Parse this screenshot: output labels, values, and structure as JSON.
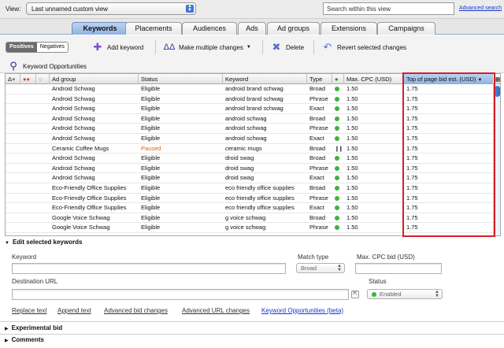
{
  "topbar": {
    "view_label": "View:",
    "view_value": "Last unnamed custom view",
    "search_placeholder": "Search within this view",
    "advanced_search": "Advanced search"
  },
  "tabs": [
    {
      "label": "Keywords",
      "active": true
    },
    {
      "label": "Placements"
    },
    {
      "label": "Audiences"
    },
    {
      "label": "Ads"
    },
    {
      "label": "Ad groups"
    },
    {
      "label": "Extensions"
    },
    {
      "label": "Campaigns"
    }
  ],
  "toolbar": {
    "positives": "Positives",
    "negatives": "Negatives",
    "add_keyword": "Add keyword",
    "make_multiple": "Make multiple changes",
    "delete": "Delete",
    "revert": "Revert selected changes",
    "keyword_opportunities": "Keyword Opportunities"
  },
  "grid": {
    "columns": [
      "Ad group",
      "Status",
      "Keyword",
      "Type",
      "Max. CPC (USD)",
      "Top of page bid est. (USD)"
    ],
    "rows": [
      {
        "ad_group": "Android Schwag",
        "status": "Eligible",
        "keyword": "android brand schwag",
        "type": "Broad",
        "icon": "dot",
        "cpc": "1.50",
        "top": "1.75"
      },
      {
        "ad_group": "Android Schwag",
        "status": "Eligible",
        "keyword": "android brand schwag",
        "type": "Phrase",
        "icon": "dot",
        "cpc": "1.50",
        "top": "1.75"
      },
      {
        "ad_group": "Android Schwag",
        "status": "Eligible",
        "keyword": "android brand schwag",
        "type": "Exact",
        "icon": "dot",
        "cpc": "1.50",
        "top": "1.75"
      },
      {
        "ad_group": "Android Schwag",
        "status": "Eligible",
        "keyword": "android schwag",
        "type": "Broad",
        "icon": "dot",
        "cpc": "1.50",
        "top": "1.75"
      },
      {
        "ad_group": "Android Schwag",
        "status": "Eligible",
        "keyword": "android schwag",
        "type": "Phrase",
        "icon": "dot",
        "cpc": "1.50",
        "top": "1.75"
      },
      {
        "ad_group": "Android Schwag",
        "status": "Eligible",
        "keyword": "android schwag",
        "type": "Exact",
        "icon": "dot",
        "cpc": "1.50",
        "top": "1.75"
      },
      {
        "ad_group": "Ceramic Coffee Mugs",
        "status": "Paused",
        "keyword": "ceramic mugs",
        "type": "Broad",
        "icon": "pause",
        "cpc": "1.50",
        "top": "1.75"
      },
      {
        "ad_group": "Android Schwag",
        "status": "Eligible",
        "keyword": "droid swag",
        "type": "Broad",
        "icon": "dot",
        "cpc": "1.50",
        "top": "1.75"
      },
      {
        "ad_group": "Android Schwag",
        "status": "Eligible",
        "keyword": "droid swag",
        "type": "Phrase",
        "icon": "dot",
        "cpc": "1.50",
        "top": "1.75"
      },
      {
        "ad_group": "Android Schwag",
        "status": "Eligible",
        "keyword": "droid swag",
        "type": "Exact",
        "icon": "dot",
        "cpc": "1.50",
        "top": "1.75"
      },
      {
        "ad_group": "Eco-Friendly Office Supplies",
        "status": "Eligible",
        "keyword": "eco friendly office supplies",
        "type": "Broad",
        "icon": "dot",
        "cpc": "1.50",
        "top": "1.75"
      },
      {
        "ad_group": "Eco-Friendly Office Supplies",
        "status": "Eligible",
        "keyword": "eco friendly office supplies",
        "type": "Phrase",
        "icon": "dot",
        "cpc": "1.50",
        "top": "1.75"
      },
      {
        "ad_group": "Eco-Friendly Office Supplies",
        "status": "Eligible",
        "keyword": "eco friendly office supplies",
        "type": "Exact",
        "icon": "dot",
        "cpc": "1.50",
        "top": "1.75"
      },
      {
        "ad_group": "Google Voice Schwag",
        "status": "Eligible",
        "keyword": "g voice schwag",
        "type": "Broad",
        "icon": "dot",
        "cpc": "1.50",
        "top": "1.75"
      },
      {
        "ad_group": "Google Voice Schwag",
        "status": "Eligible",
        "keyword": "g voice schwag",
        "type": "Phrase",
        "icon": "dot",
        "cpc": "1.50",
        "top": "1.75"
      }
    ]
  },
  "edit": {
    "title": "Edit selected keywords",
    "keyword_label": "Keyword",
    "match_type_label": "Match type",
    "match_type_value": "Broad",
    "max_cpc_label": "Max. CPC bid (USD)",
    "dest_url_label": "Destination URL",
    "status_label": "Status",
    "status_value": "Enabled",
    "links": [
      "Replace text",
      "Append text",
      "Advanced bid changes",
      "Advanced URL changes",
      "Keyword Opportunities (beta)"
    ]
  },
  "sections": {
    "experimental": "Experimental bid",
    "comments": "Comments"
  },
  "colors": {
    "accent": "#8fb1e0",
    "highlight": "#d41f26",
    "paused": "#d9641a",
    "eligible_dot": "#3cb43c"
  }
}
